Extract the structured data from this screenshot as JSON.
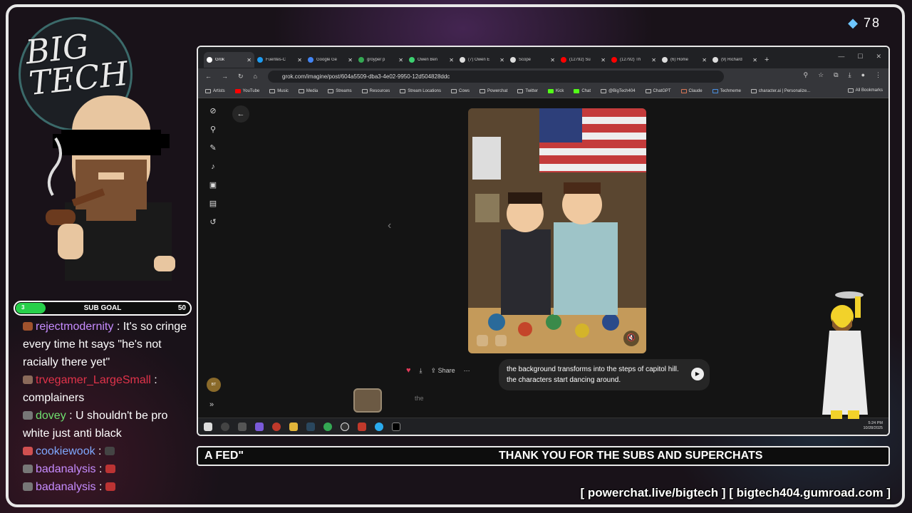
{
  "overlay": {
    "logo": {
      "line1": "BIG",
      "line2": "TECH"
    },
    "gem_count": "78",
    "sub_goal": {
      "label": "SUB GOAL",
      "current": "3",
      "max": "50",
      "progress": 0.06
    },
    "ticker_left": "A FED\"",
    "ticker_right": "THANK YOU FOR THE SUBS AND SUPERCHATS",
    "links": "[ powerchat.live/bigtech ] [ bigtech404.gumroad.com ]"
  },
  "chat": [
    {
      "user": "rejectmodernity",
      "color": "#c68cff",
      "badge": "#a0522d",
      "text": "It's so cringe every time ht says \"he's not racially there yet\""
    },
    {
      "user": "trvegamer_LargeSmall",
      "color": "#e0334a",
      "badge": "#8a6a5a",
      "text": "complainers"
    },
    {
      "user": "dovey",
      "color": "#6fe06f",
      "badge": "#777777",
      "text": "U shouldn't be pro white just anti black"
    },
    {
      "user": "cookiewook",
      "color": "#7fa8ff",
      "badge": "#d05050",
      "text": ""
    },
    {
      "user": "badanalysis",
      "color": "#c68cff",
      "badge": "#777777",
      "text": ""
    },
    {
      "user": "badanalysis",
      "color": "#c68cff",
      "badge": "#777777",
      "text": ""
    }
  ],
  "browser": {
    "tabs": [
      {
        "title": "Grok",
        "fav": "#ffffff",
        "active": true
      },
      {
        "title": "Fuentes-C",
        "fav": "#1d9bf0"
      },
      {
        "title": "Google Ge",
        "fav": "#4285f4"
      },
      {
        "title": "groyper p",
        "fav": "#34a853"
      },
      {
        "title": "Owen Ben",
        "fav": "#3cd070"
      },
      {
        "title": "(7) Owen E",
        "fav": "#dddddd"
      },
      {
        "title": "Scope",
        "fav": "#dddddd"
      },
      {
        "title": "(12792) Su",
        "fav": "#ff0000"
      },
      {
        "title": "(12792) Th",
        "fav": "#ff0000"
      },
      {
        "title": "(6) Home",
        "fav": "#dddddd"
      },
      {
        "title": "(9) Richard",
        "fav": "#dddddd"
      }
    ],
    "url": "grok.com/imagine/post/604a5509-dba3-4e02-9950-12d504828ddc",
    "bookmarks": [
      "Artists",
      "YouTube",
      "Music",
      "Media",
      "Streams",
      "Resources",
      "Stream Locations",
      "Cows",
      "Powerchat",
      "Twitter",
      "Kick",
      "Chat",
      "@BigTech404",
      "ChatGPT",
      "Claude",
      "Techmeme",
      "character.ai | Personalize..."
    ],
    "all_bookmarks": "All Bookmarks",
    "share_label": "Share",
    "prompt_text": "the background transforms into the steps of capitol hill. the characters start dancing around.",
    "input_placeholder": "the",
    "clock": {
      "time": "5:24 PM",
      "date": "10/28/2025"
    }
  }
}
